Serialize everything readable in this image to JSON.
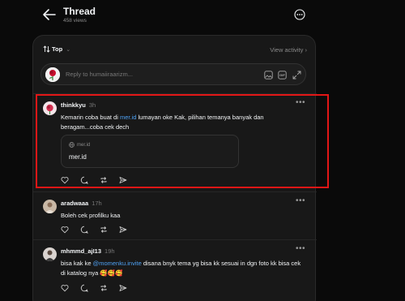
{
  "header": {
    "title": "Thread",
    "views": "458 views"
  },
  "sortbar": {
    "sort_label": "Top",
    "view_activity": "View activity"
  },
  "reply_box": {
    "placeholder": "Reply to humaiiraarizm..."
  },
  "posts": [
    {
      "username": "thinkkyu",
      "time": "3h",
      "text_before": "Kemarin coba buat di ",
      "link": "mer.id",
      "text_after": " lumayan oke Kak, pilihan temanya banyak dan beragam...coba cek dech",
      "card": {
        "domain": "mer.id",
        "title": "mer.id"
      }
    },
    {
      "username": "aradwaaa",
      "time": "17h",
      "text": "Boleh cek profilku kaa"
    },
    {
      "username": "mhmmd_ajI13",
      "time": "19h",
      "text_before": "bisa kak ke ",
      "link": "@momenku.invite",
      "text_after": " disana bnyk tema yg bisa kk sesuai in dgn foto kk bisa cek di katalog nya 🥰🥰🥰"
    }
  ],
  "colors": {
    "link": "#4ea1f3",
    "highlight": "#e21616",
    "background": "#0a0a0a",
    "panel": "#181818"
  }
}
